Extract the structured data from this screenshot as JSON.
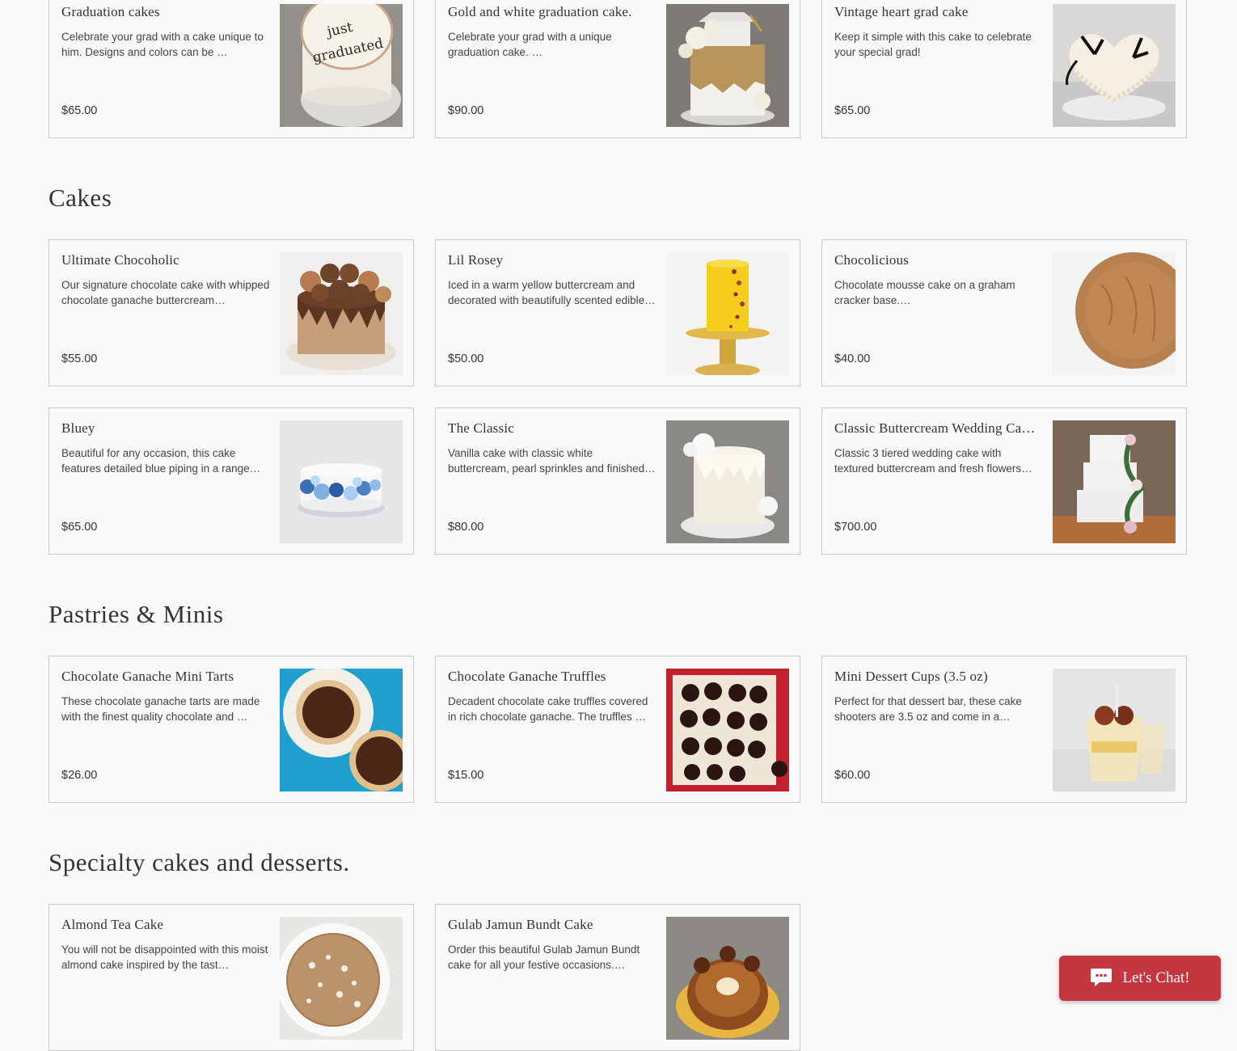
{
  "sections": {
    "cakes": {
      "title": "Cakes"
    },
    "pastries": {
      "title": "Pastries & Minis"
    },
    "specialty": {
      "title": "Specialty cakes and desserts."
    }
  },
  "items": [
    {
      "name": "Graduation cakes",
      "desc": "Celebrate your grad with a cake unique to him. Designs and colors can be …",
      "price": "$65.00",
      "image": "graduation-cake-photo"
    },
    {
      "name": "Gold and white graduation cake.",
      "desc": "Celebrate your grad with a unique graduation cake. …",
      "price": "$90.00",
      "image": "gold-white-graduation-cake-photo"
    },
    {
      "name": "Vintage heart grad cake",
      "desc": "Keep it simple with this cake to celebrate your special grad!",
      "price": "$65.00",
      "image": "vintage-heart-cake-photo"
    },
    {
      "name": "Ultimate Chocoholic",
      "desc": "Our signature chocolate cake with whipped chocolate ganache buttercream…",
      "price": "$55.00",
      "image": "chocolate-drip-cake-photo"
    },
    {
      "name": "Lil Rosey",
      "desc": "Iced in a warm yellow buttercream and decorated with beautifully scented edible…",
      "price": "$50.00",
      "image": "yellow-rose-cake-photo"
    },
    {
      "name": "Chocolicious",
      "desc": "Chocolate mousse cake on a graham cracker base.…",
      "price": "$40.00",
      "image": "chocolate-mousse-cake-photo"
    },
    {
      "name": "Bluey",
      "desc": "Beautiful for any occasion, this cake features detailed blue piping in a range…",
      "price": "$65.00",
      "image": "blue-piped-cake-photo"
    },
    {
      "name": "The Classic",
      "desc": "Vanilla cake with classic white buttercream, pearl sprinkles and finished…",
      "price": "$80.00",
      "image": "white-classic-cake-photo"
    },
    {
      "name": "Classic Buttercream Wedding Ca…",
      "desc": "Classic 3 tiered wedding cake with textured buttercream and fresh flowers…",
      "price": "$700.00",
      "image": "wedding-cake-photo"
    },
    {
      "name": "Chocolate Ganache Mini Tarts",
      "desc": "These chocolate ganache tarts are made with the finest quality chocolate and …",
      "price": "$26.00",
      "image": "mini-tarts-photo"
    },
    {
      "name": "Chocolate Ganache Truffles",
      "desc": "Decadent chocolate cake truffles covered in rich chocolate ganache. The truffles …",
      "price": "$15.00",
      "image": "truffles-box-photo"
    },
    {
      "name": "Mini Dessert Cups (3.5 oz)",
      "desc": "Perfect for that dessert bar, these cake shooters are 3.5 oz and come in a variety…",
      "price": "$60.00",
      "image": "dessert-cups-photo"
    },
    {
      "name": "Almond Tea Cake",
      "desc": "You will not be disappointed with this moist almond cake inspired by the tast…",
      "price": "",
      "image": "almond-cake-photo"
    },
    {
      "name": "Gulab Jamun Bundt Cake",
      "desc": "Order this beautiful Gulab Jamun Bundt cake for all your festive occasions.…",
      "price": "",
      "image": "bundt-cake-photo"
    }
  ],
  "chat": {
    "label": "Let's Chat!",
    "icon": "chat-bubble-icon"
  },
  "colors": {
    "chat_button": "#c6363f",
    "background": "#f9f9f9",
    "card_border": "#c9c9c9"
  }
}
